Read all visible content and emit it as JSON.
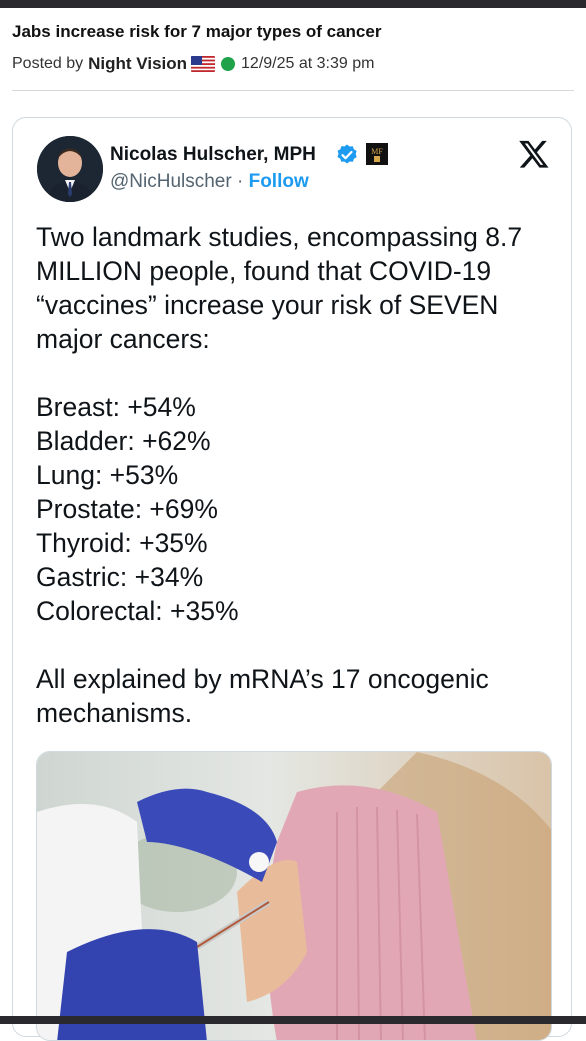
{
  "post": {
    "title": "Jabs increase risk for 7 major types of cancer",
    "posted_by_label": "Posted by",
    "author": "Night Vision",
    "flag_icon": "us-flag-icon",
    "status_color": "#1fa24a",
    "timestamp": "12/9/25 at 3:39 pm"
  },
  "tweet": {
    "display_name": "Nicolas Hulscher, MPH",
    "handle": "@NicHulscher",
    "separator": "·",
    "follow_label": "Follow",
    "brand_icon": "x-logo-icon",
    "verified_color": "#1d9bf0",
    "intro": "Two landmark studies, encompassing 8.7 MILLION people, found that COVID-19 “vaccines” increase your risk of SEVEN major cancers:",
    "list": [
      "Breast: +54%",
      "Bladder: +62%",
      "Lung: +53%",
      "Prostate: +69%",
      "Thyroid: +35%",
      "Gastric: +34%",
      "Colorectal: +35%"
    ],
    "closing": "All explained by mRNA’s 17 oncogenic mechanisms."
  }
}
